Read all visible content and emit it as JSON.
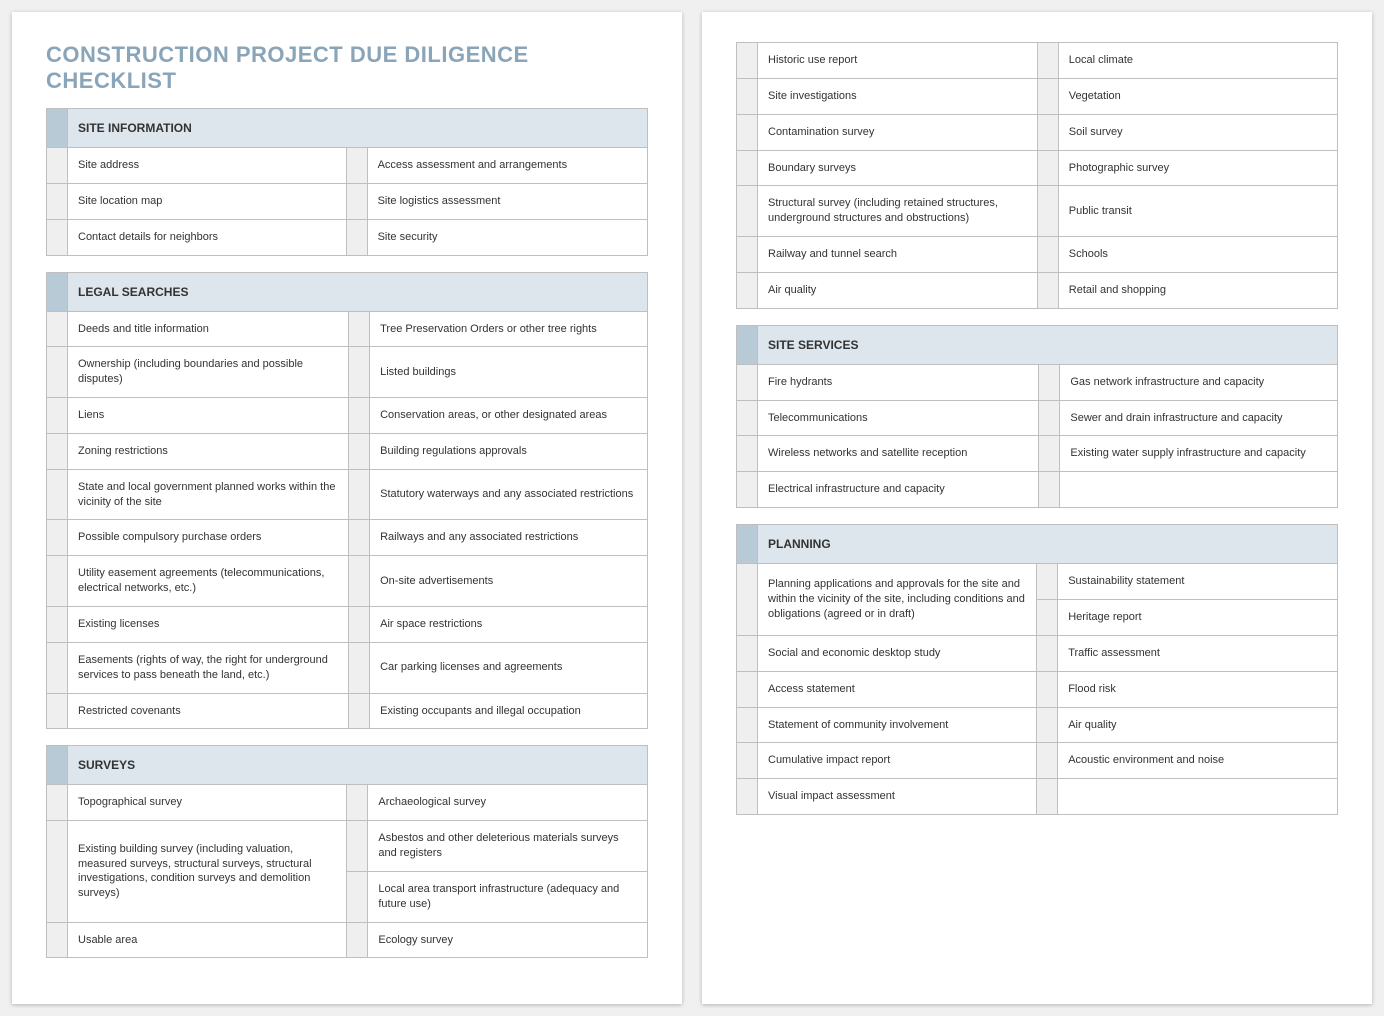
{
  "title": "CONSTRUCTION PROJECT DUE DILIGENCE CHECKLIST",
  "sections": {
    "siteInfo": {
      "header": "SITE INFORMATION",
      "left": [
        "Site address",
        "Site location map",
        "Contact details for neighbors"
      ],
      "right": [
        "Access assessment and arrangements",
        "Site logistics assessment",
        "Site security"
      ]
    },
    "legal": {
      "header": "LEGAL SEARCHES",
      "left": [
        "Deeds and title information",
        "Ownership (including boundaries and possible disputes)",
        "Liens",
        "Zoning restrictions",
        "State and local government planned works within the vicinity of the site",
        "Possible compulsory purchase orders",
        "Utility easement agreements (telecommunications, electrical networks, etc.)",
        "Existing licenses",
        "Easements (rights of way, the right for underground services to pass beneath the land, etc.)",
        "Restricted covenants"
      ],
      "right": [
        "Tree Preservation Orders or other tree rights",
        "Listed buildings",
        "Conservation areas, or other designated areas",
        "Building regulations approvals",
        "Statutory waterways and any associated restrictions",
        "Railways and any associated restrictions",
        "On-site advertisements",
        "Air space restrictions",
        "Car parking licenses and agreements",
        "Existing occupants and illegal occupation"
      ]
    },
    "surveys": {
      "header": "SURVEYS",
      "leftPage1": [
        "Topographical survey",
        "Existing building survey (including valuation, measured surveys, structural surveys, structural investigations, condition surveys and demolition surveys)",
        "Usable area"
      ],
      "rightPage1": [
        "Archaeological survey",
        "Asbestos and other deleterious materials surveys and registers",
        "Local area transport infrastructure (adequacy and future use)",
        "Ecology survey"
      ],
      "leftPage2": [
        "Historic use report",
        "Site investigations",
        "Contamination survey",
        "Boundary surveys",
        "Structural survey (including retained structures, underground structures and obstructions)",
        "Railway and tunnel search",
        "Air quality"
      ],
      "rightPage2": [
        "Local climate",
        "Vegetation",
        "Soil survey",
        "Photographic survey",
        "Public transit",
        "Schools",
        "Retail and shopping"
      ]
    },
    "siteServices": {
      "header": "SITE SERVICES",
      "left": [
        "Fire hydrants",
        "Telecommunications",
        "Wireless networks and satellite reception",
        "Electrical infrastructure and capacity"
      ],
      "right": [
        "Gas network infrastructure and capacity",
        "Sewer and drain infrastructure and capacity",
        "Existing water supply infrastructure and capacity",
        ""
      ]
    },
    "planning": {
      "header": "PLANNING",
      "left": [
        "Planning applications and approvals for the site and within the vicinity of the site, including conditions and obligations (agreed or in draft)",
        "Social and economic desktop study",
        "Access statement",
        "Statement of community involvement",
        "Cumulative impact report",
        "Visual impact assessment"
      ],
      "right": [
        "Sustainability statement",
        "Heritage report",
        "Traffic assessment",
        "Flood risk",
        "Air quality",
        "Acoustic environment and noise",
        ""
      ]
    }
  }
}
